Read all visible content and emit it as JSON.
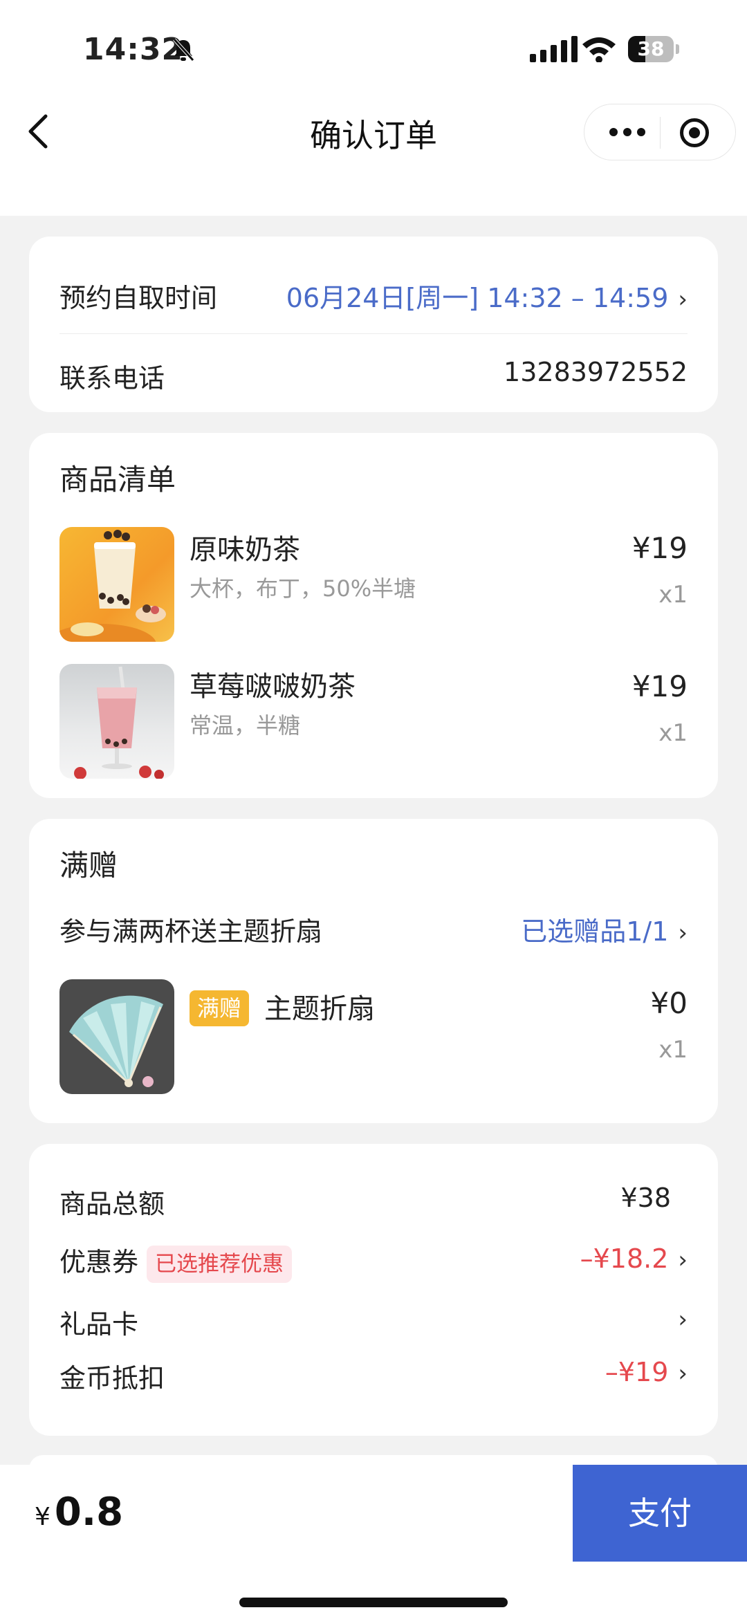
{
  "status_bar": {
    "time": "14:32",
    "battery": "38"
  },
  "nav": {
    "title": "确认订单"
  },
  "pickup": {
    "time_label": "预约自取时间",
    "time_value": "06月24日[周一] 14:32 – 14:59",
    "phone_label": "联系电话",
    "phone_value": "13283972552"
  },
  "goods": {
    "title": "商品清单",
    "items": [
      {
        "name": "原味奶茶",
        "options": "大杯，布丁，50%半塘",
        "price": "¥19",
        "qty": "x1"
      },
      {
        "name": "草莓啵啵奶茶",
        "options": "常温，半糖",
        "price": "¥19",
        "qty": "x1"
      }
    ]
  },
  "gift": {
    "title": "满赠",
    "promo_label": "参与满两杯送主题折扇",
    "promo_value": "已选赠品1/1",
    "tag": "满赠",
    "item_name": "主题折扇",
    "price": "¥0",
    "qty": "x1"
  },
  "summary": {
    "total_label": "商品总额",
    "total_value": "¥38",
    "coupon_label": "优惠券",
    "coupon_tag": "已选推荐优惠",
    "coupon_value": "–¥18.2",
    "giftcard_label": "礼品卡",
    "coins_label": "金币抵扣",
    "coins_value": "–¥19"
  },
  "bottom": {
    "currency": "¥",
    "amount": "0.8",
    "pay_label": "支付"
  },
  "icons": {
    "back": "chevron-left-icon",
    "more": "more-dots-icon",
    "target": "target-icon",
    "chevron": "chevron-right-icon"
  },
  "colors": {
    "accent_blue": "#4a6bc8",
    "discount_red": "#e5484d",
    "pay_button": "#3e64d2",
    "gift_tag": "#f5b731"
  }
}
